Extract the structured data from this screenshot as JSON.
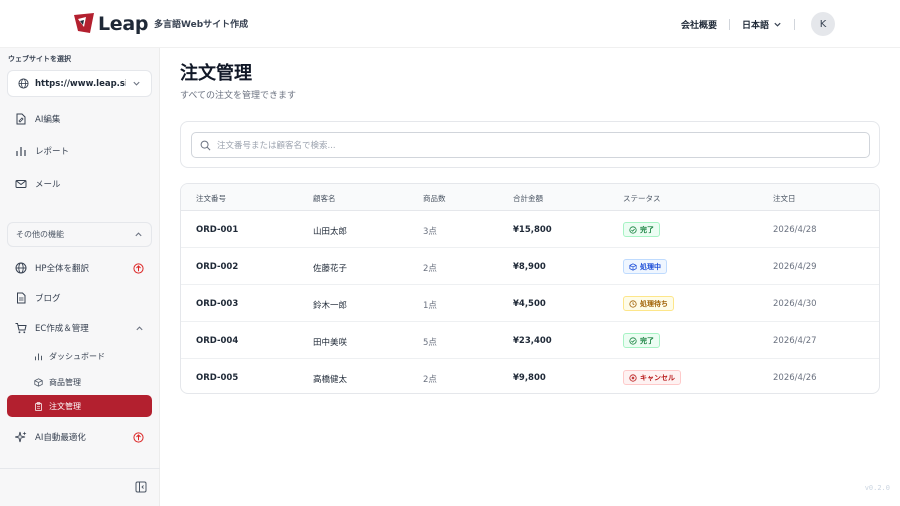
{
  "header": {
    "brand": "Leap",
    "tagline": "多言語Webサイト作成",
    "company_link": "会社概要",
    "language": "日本語",
    "avatar_initial": "K"
  },
  "sidebar": {
    "site_label": "ウェブサイトを選択",
    "site_url": "https://www.leap.sit...",
    "items": [
      {
        "label": "AI編集",
        "icon": "ai-edit-icon"
      },
      {
        "label": "レポート",
        "icon": "bar-chart-icon"
      },
      {
        "label": "メール",
        "icon": "mail-icon"
      }
    ],
    "section_label": "その他の機能",
    "more_items": [
      {
        "label": "HP全体を翻訳",
        "icon": "globe-icon"
      },
      {
        "label": "ブログ",
        "icon": "document-icon"
      },
      {
        "label": "EC作成＆管理",
        "icon": "cart-icon"
      }
    ],
    "ec_sub_items": [
      {
        "label": "ダッシュボード",
        "icon": "bar-chart-icon"
      },
      {
        "label": "商品管理",
        "icon": "box-icon"
      },
      {
        "label": "注文管理",
        "icon": "clipboard-icon"
      }
    ],
    "ai_optimize": "AI自動最適化"
  },
  "main": {
    "title": "注文管理",
    "subtitle": "すべての注文を管理できます",
    "search_placeholder": "注文番号または顧客名で検索...",
    "columns": [
      "注文番号",
      "顧客名",
      "商品数",
      "合計金額",
      "ステータス",
      "注文日"
    ],
    "orders": [
      {
        "id": "ORD-001",
        "customer": "山田太郎",
        "items": "3点",
        "total": "¥15,800",
        "status": "完了",
        "date": "2026/4/28"
      },
      {
        "id": "ORD-002",
        "customer": "佐藤花子",
        "items": "2点",
        "total": "¥8,900",
        "status": "処理中",
        "date": "2026/4/29"
      },
      {
        "id": "ORD-003",
        "customer": "鈴木一郎",
        "items": "1点",
        "total": "¥4,500",
        "status": "処理待ち",
        "date": "2026/4/30"
      },
      {
        "id": "ORD-004",
        "customer": "田中美咲",
        "items": "5点",
        "total": "¥23,400",
        "status": "完了",
        "date": "2026/4/27"
      },
      {
        "id": "ORD-005",
        "customer": "高橋健太",
        "items": "2点",
        "total": "¥9,800",
        "status": "キャンセル",
        "date": "2026/4/26"
      }
    ]
  },
  "version": "v0.2.0",
  "colors": {
    "accent": "#b3202f",
    "done": "#15803d",
    "processing": "#1d4ed8",
    "pending": "#a16207",
    "cancelled": "#b91c1c"
  }
}
